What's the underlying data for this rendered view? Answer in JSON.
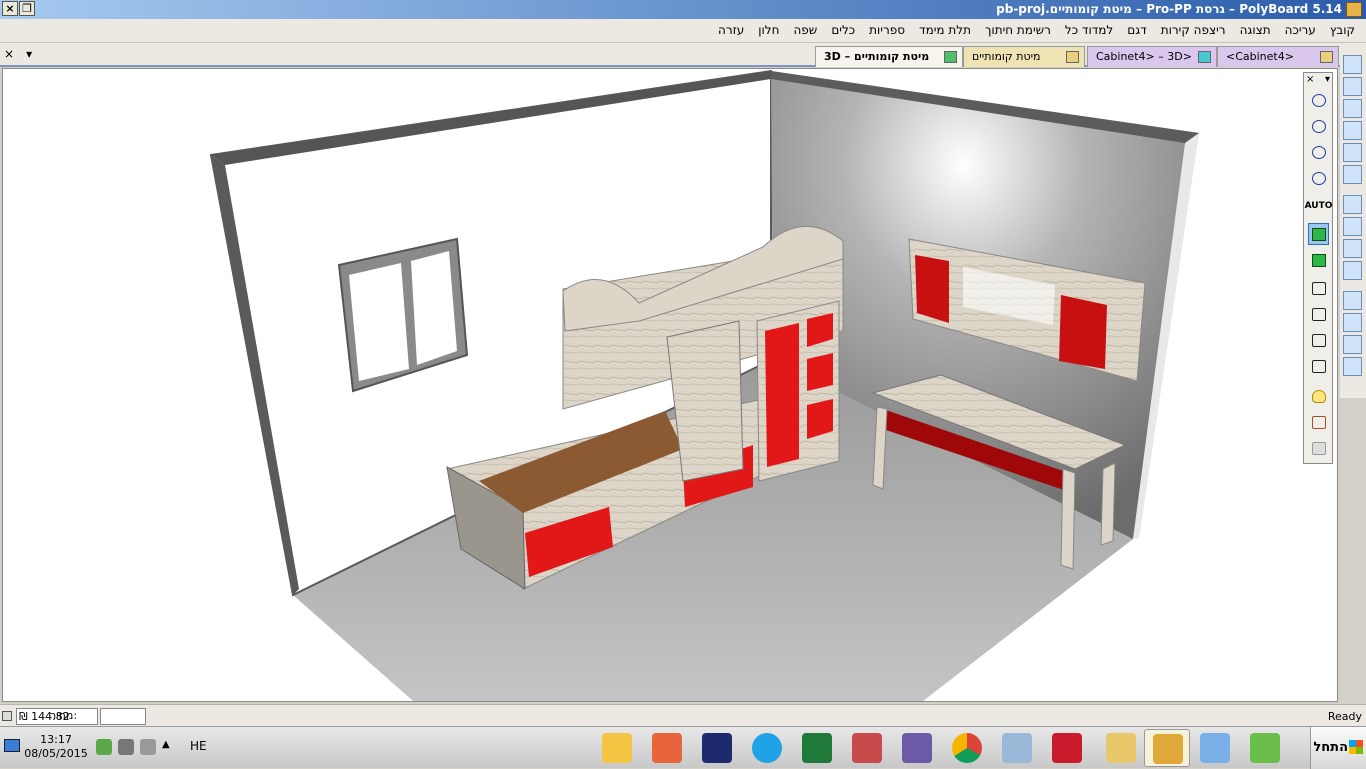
{
  "window": {
    "title": "PolyBoard 5.14 – גרסת Pro-PP – מיטת קומותיים.pb-proj",
    "controls": [
      "×",
      "❐",
      "_"
    ]
  },
  "menu": {
    "items": [
      "קובץ",
      "עריכה",
      "תצוגה",
      "ריצפה קירות",
      "דגם",
      "למדוד כל",
      "רשימת חיתוך",
      "תלת מימד",
      "ספריות",
      "כלים",
      "שפה",
      "חלון",
      "עזרה"
    ]
  },
  "tabs": [
    {
      "label": "3D – מיטת קומותיים",
      "active": true
    },
    {
      "label": "מיטת קומותיים",
      "active": false
    },
    {
      "label": "Cabinet4> – 3D>",
      "active": false
    },
    {
      "label": "<Cabinet4>",
      "active": false
    }
  ],
  "tabbar_left": {
    "close": "×",
    "dropdown": "▾"
  },
  "floating_panel": {
    "close": "×",
    "dropdown": "▾",
    "auto_label": "AUTO"
  },
  "status": {
    "price_label": "מחיר:",
    "price_value": "₪ 144.82",
    "ready": "Ready"
  },
  "taskbar": {
    "time": "13:17",
    "date": "08/05/2015",
    "language": "HE",
    "start_label": "התחל",
    "apps": [
      "outlook-icon",
      "network-icon",
      "visual-studio-icon",
      "skype-icon",
      "terminal-icon",
      "keyboard-icon",
      "tools-icon",
      "chrome-icon",
      "calculator-icon",
      "n-app-icon",
      "folder-icon",
      "polyboard-icon",
      "paint-icon",
      "chart-icon"
    ]
  },
  "colors": {
    "title_gradient_start": "#a6caf0",
    "title_gradient_end": "#2a5caa",
    "front_red": "#e21818",
    "wood": "#d8d2c4",
    "floor": "#a8a8a8"
  }
}
